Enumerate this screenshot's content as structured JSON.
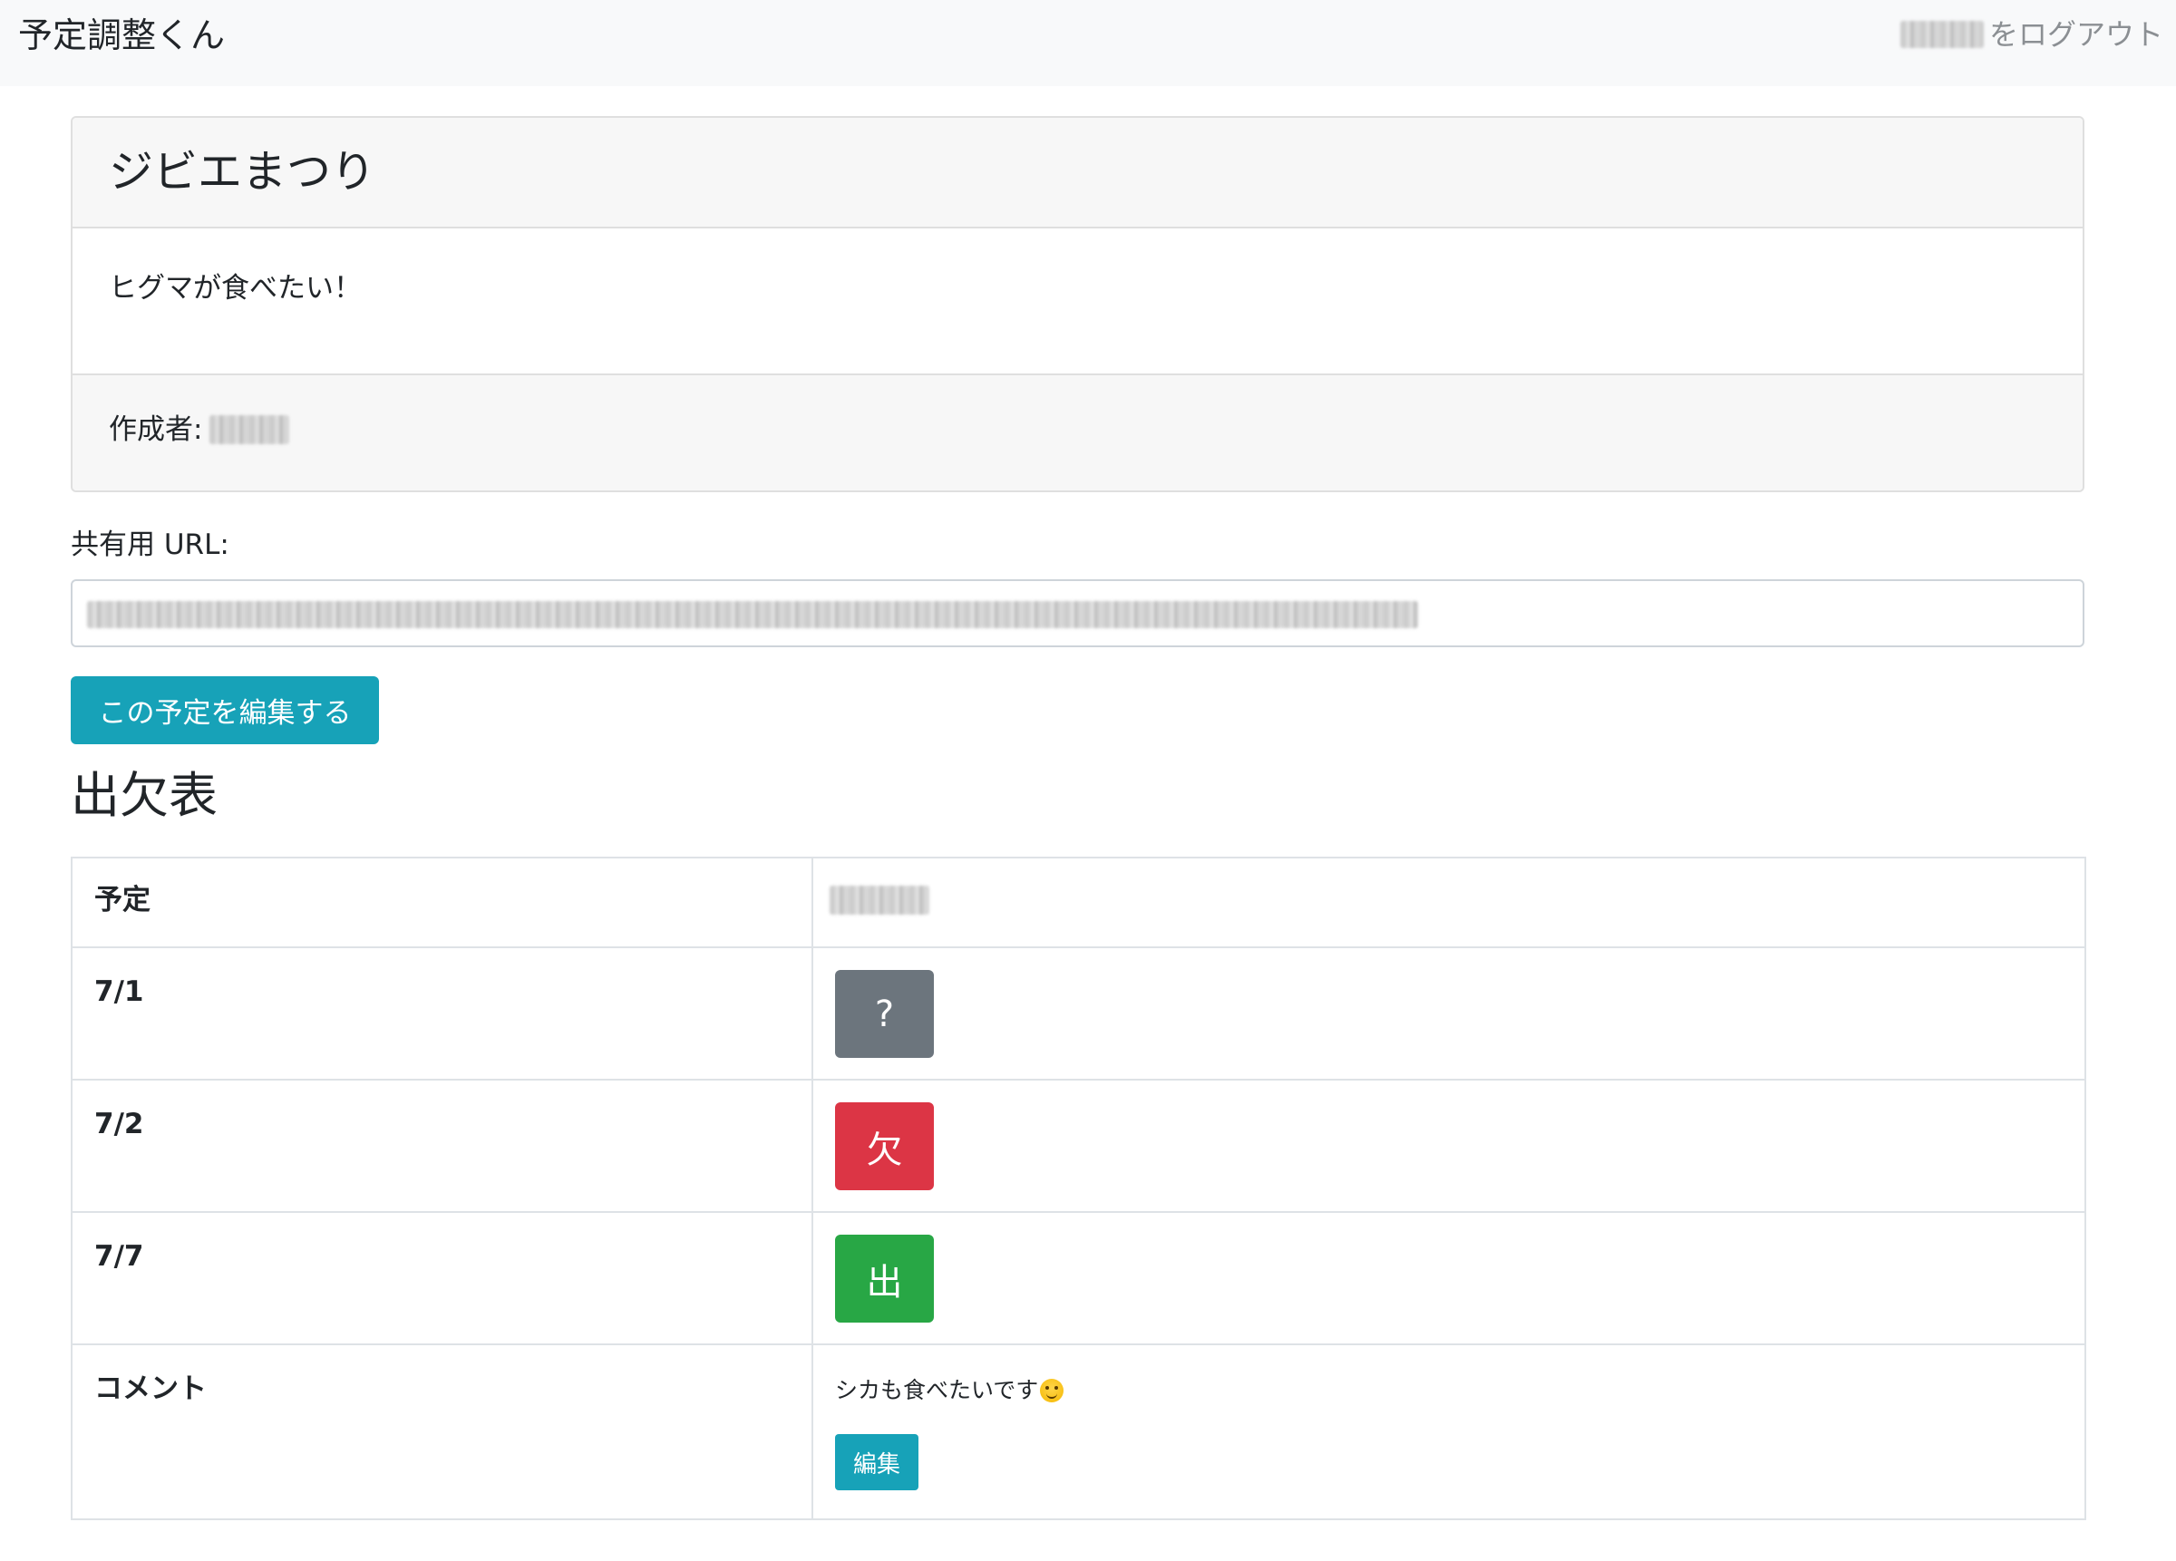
{
  "navbar": {
    "brand": "予定調整くん",
    "logout_suffix": "をログアウト"
  },
  "schedule": {
    "title": "ジビエまつり",
    "memo": "ヒグマが食べたい！",
    "creator_label": "作成者:"
  },
  "share": {
    "label": "共有用 URL:"
  },
  "edit_button_label": "この予定を編集する",
  "attendance": {
    "heading": "出欠表",
    "header_label": "予定",
    "rows": [
      {
        "date": "7/1",
        "status": "?",
        "status_color": "#6c757d"
      },
      {
        "date": "7/2",
        "status": "欠",
        "status_color": "#dc3545"
      },
      {
        "date": "7/7",
        "status": "出",
        "status_color": "#28a745"
      }
    ],
    "comment_label": "コメント",
    "comment_text": "シカも食べたいです",
    "comment_emoji": "yum-face-emoji",
    "comment_edit_label": "編集"
  },
  "colors": {
    "navbar_bg": "#f8f9fa",
    "info": "#17a2b8",
    "secondary": "#6c757d",
    "danger": "#dc3545",
    "success": "#28a745"
  }
}
